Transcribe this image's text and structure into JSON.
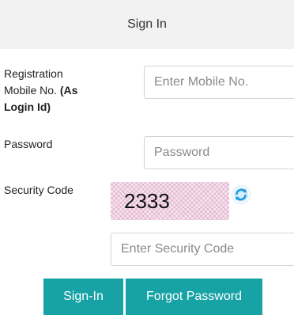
{
  "header": {
    "title": "Sign In"
  },
  "form": {
    "mobile": {
      "label_line1": "Registration",
      "label_line2_plain": "Mobile No. ",
      "label_line2_bold": "(As",
      "label_line3_bold": "Login Id)",
      "placeholder": "Enter Mobile No.",
      "value": ""
    },
    "password": {
      "label": "Password",
      "placeholder": "Password",
      "value": ""
    },
    "security": {
      "label": "Security Code",
      "captcha_text": "2333",
      "refresh_icon": "refresh-icon",
      "placeholder": "Enter Security Code",
      "value": ""
    }
  },
  "buttons": {
    "signin_label": "Sign-In",
    "forgot_label": "Forgot Password"
  },
  "colors": {
    "header_bg": "#f2f2f2",
    "button_bg": "#17a2a6",
    "input_border": "#d4d4d4",
    "refresh_icon": "#1e9be0"
  }
}
